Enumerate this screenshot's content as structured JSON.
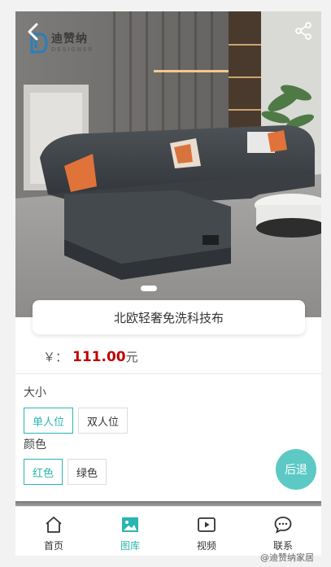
{
  "header": {
    "logo_cn": "迪赞纳",
    "logo_en": "DESIGNER"
  },
  "product": {
    "title": "北欧轻奢免洗科技布",
    "price_symbol": "￥：",
    "price_value": "111.00",
    "price_unit": "元"
  },
  "carousel": {
    "current": 1,
    "total": 1
  },
  "specs": {
    "size": {
      "label": "大小",
      "options": [
        "单人位",
        "双人位"
      ],
      "selected": "单人位"
    },
    "color": {
      "label": "颜色",
      "options": [
        "红色",
        "绿色"
      ],
      "selected": "红色"
    }
  },
  "fab": {
    "label": "后退"
  },
  "tabs": [
    {
      "label": "首页",
      "icon": "home-icon"
    },
    {
      "label": "图库",
      "icon": "gallery-icon",
      "active": true
    },
    {
      "label": "视频",
      "icon": "video-icon"
    },
    {
      "label": "联系",
      "icon": "chat-icon"
    }
  ],
  "watermark": "@迪赞纳家居",
  "colors": {
    "accent": "#2bb5b0",
    "fab": "#5cc9c5",
    "price": "#c00000"
  }
}
